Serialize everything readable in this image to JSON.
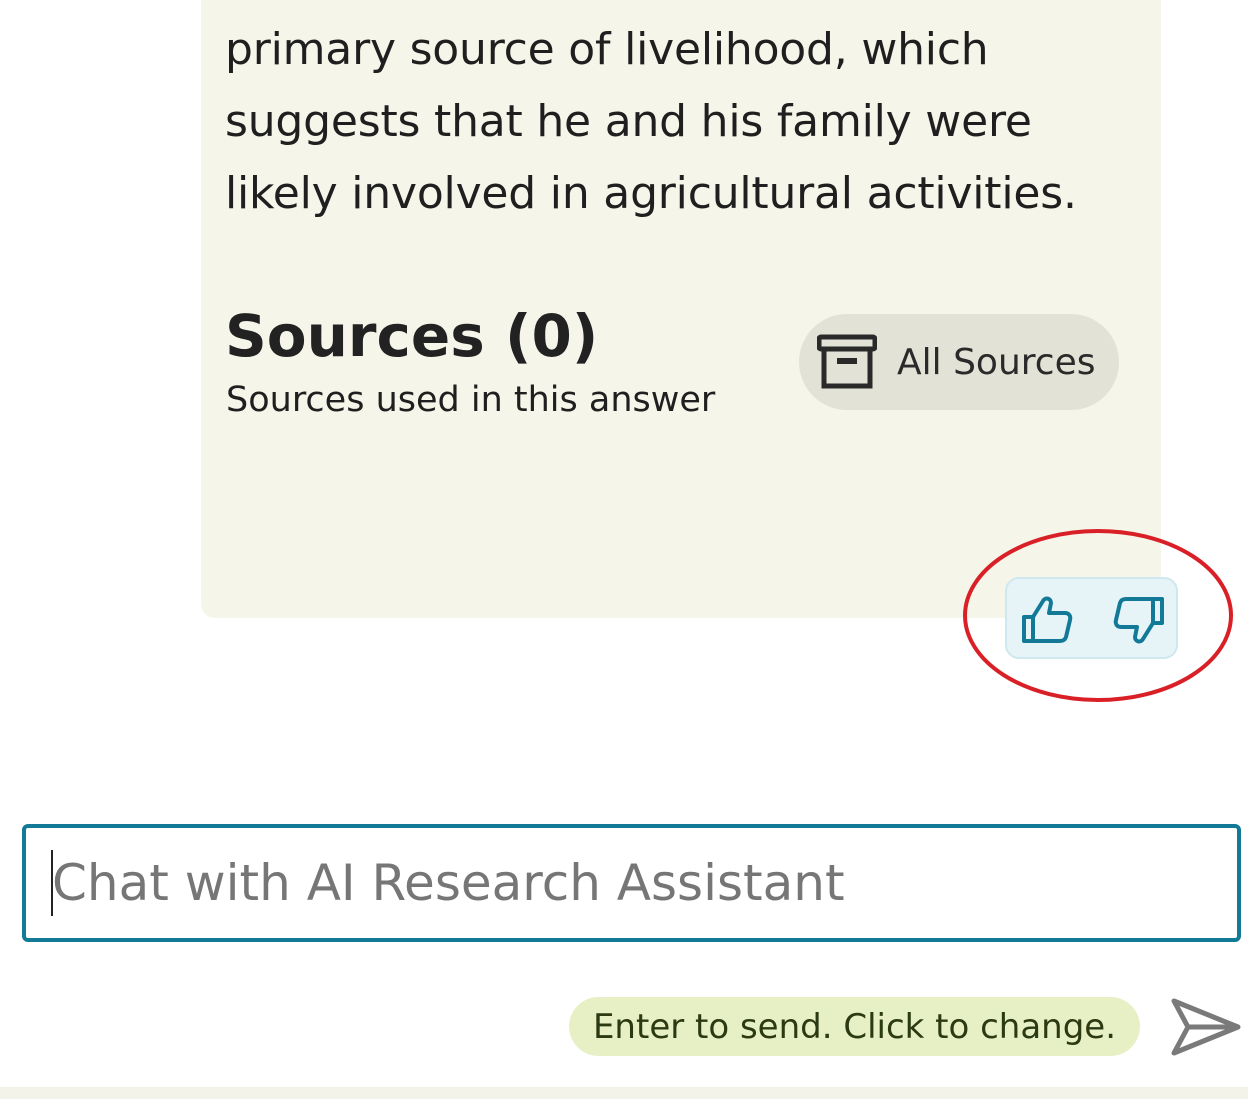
{
  "answer": {
    "lines": [
      "primary source of livelihood, which",
      "suggests that he and his family were",
      "likely involved in agricultural activities."
    ]
  },
  "sources": {
    "title": "Sources (0)",
    "subtitle": "Sources used in this answer",
    "all_sources_label": "All Sources",
    "all_sources_icon": "archive-box-icon"
  },
  "feedback": {
    "thumbs_up_icon": "thumbs-up-icon",
    "thumbs_down_icon": "thumbs-down-icon",
    "accent_color": "#127a97",
    "highlight_color": "#d92027"
  },
  "chat": {
    "placeholder": "Chat with AI Research Assistant",
    "value": "",
    "send_hint": "Enter to send. Click to change.",
    "send_icon": "paper-plane-send-icon"
  },
  "colors": {
    "card_background": "#f5f5e9",
    "input_border": "#127a97",
    "hint_background": "#e7f0c5"
  }
}
